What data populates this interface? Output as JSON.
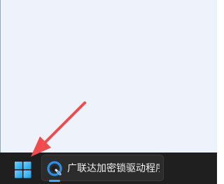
{
  "taskbar": {
    "start_icon": "windows-logo-icon",
    "app": {
      "label": "广联达加密锁驱动程序",
      "icon": "glodon-lock-driver-icon",
      "active": true
    }
  },
  "annotation": {
    "type": "arrow",
    "target": "start-button",
    "color": "#f04b4f"
  }
}
